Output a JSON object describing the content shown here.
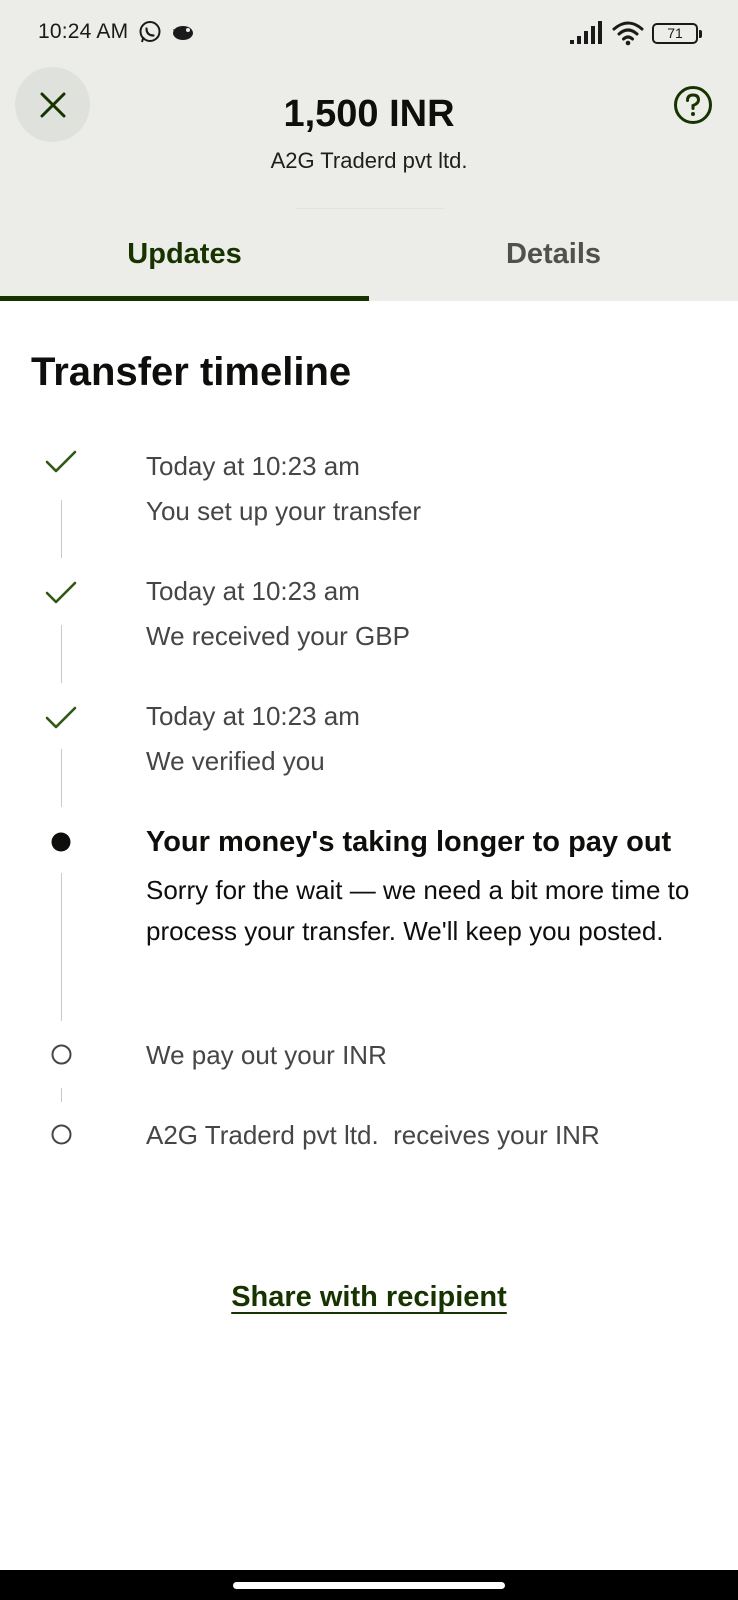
{
  "status_bar": {
    "time": "10:24 AM",
    "battery": "71",
    "icons": [
      "whatsapp-icon",
      "notification-bird-icon",
      "signal-icon",
      "wifi-icon",
      "battery-icon"
    ]
  },
  "header": {
    "amount": "1,500 INR",
    "recipient": "A2G Traderd pvt ltd.",
    "close_icon": "close-icon",
    "help_icon": "help-circle-icon"
  },
  "tabs": [
    {
      "label": "Updates",
      "active": true
    },
    {
      "label": "Details",
      "active": false
    }
  ],
  "timeline": {
    "title": "Transfer timeline",
    "steps": [
      {
        "status": "done",
        "time": "Today at 10:23 am",
        "text": "You set up your transfer"
      },
      {
        "status": "done",
        "time": "Today at 10:23 am",
        "text": "We received your GBP"
      },
      {
        "status": "done",
        "time": "Today at 10:23 am",
        "text": "We verified you"
      },
      {
        "status": "current",
        "title": "Your money's taking longer to pay out",
        "text": "Sorry for the wait — we need a bit more time to process your transfer. We'll keep you posted."
      },
      {
        "status": "pending",
        "text": "We pay out your INR"
      },
      {
        "status": "pending",
        "text": "A2G Traderd pvt ltd.  receives your INR"
      }
    ]
  },
  "share_label": "Share with recipient",
  "colors": {
    "accent": "#163300",
    "check": "#2f5711",
    "header_bg": "#ecede9",
    "text": "#0e0f0c",
    "muted": "#454745"
  }
}
